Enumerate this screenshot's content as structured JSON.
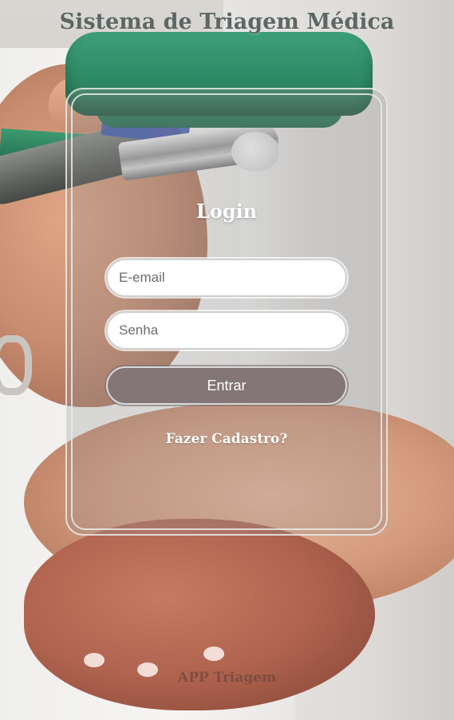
{
  "header": {
    "title": "Sistema de Triagem Médica"
  },
  "login": {
    "heading": "Login",
    "email_placeholder": "E-email",
    "password_placeholder": "Senha",
    "submit_label": "Entrar",
    "signup_link": "Fazer Cadastro?"
  },
  "footer": {
    "text": "APP Triagem"
  },
  "colors": {
    "title": "#5d6766",
    "button_bg": "#847576",
    "button_text": "#ffffff",
    "card_border": "#ebebeb",
    "heading": "#ffffff"
  },
  "background": {
    "icon": "medical-checkup-photo"
  }
}
